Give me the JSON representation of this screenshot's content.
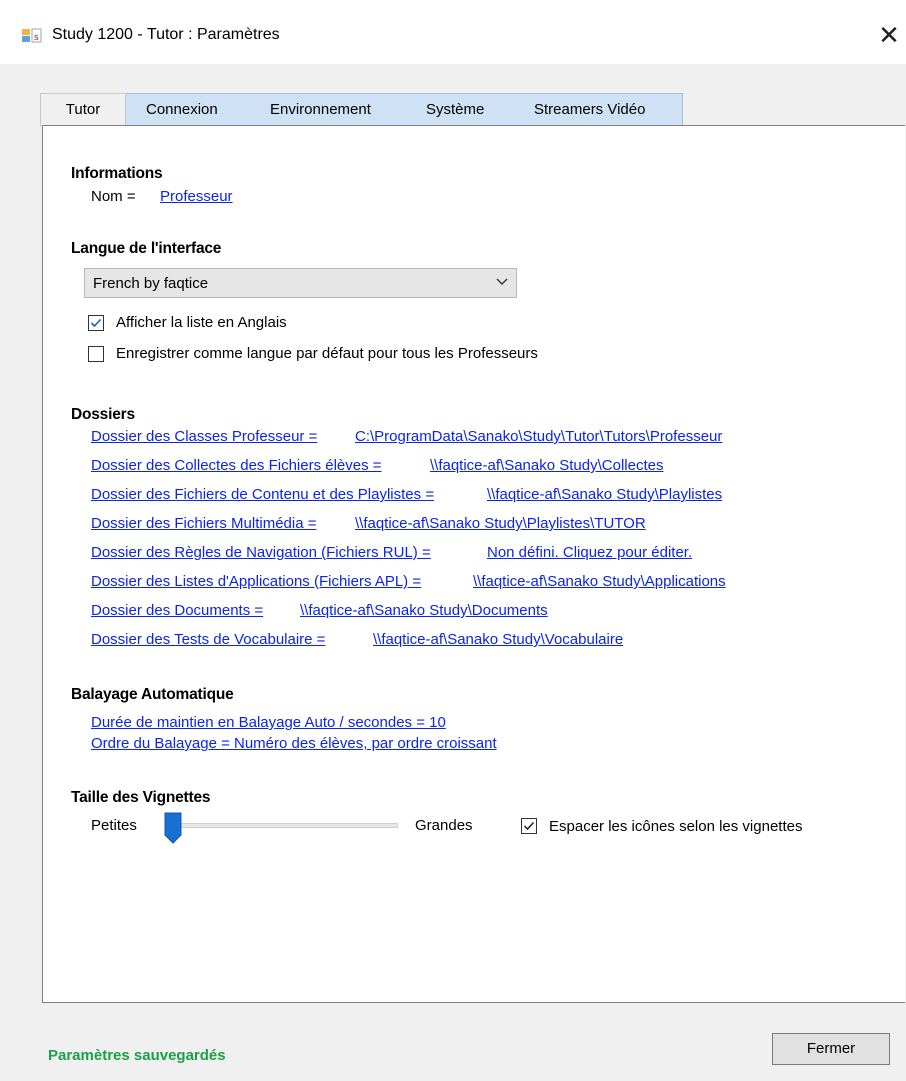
{
  "window": {
    "title": "Study 1200 - Tutor : Paramètres",
    "close_icon": "close-icon",
    "app_icon": "study-app-icon"
  },
  "tabs": [
    {
      "label": "Tutor",
      "active": true
    },
    {
      "label": "Connexion",
      "active": false
    },
    {
      "label": "Environnement",
      "active": false
    },
    {
      "label": "Système",
      "active": false
    },
    {
      "label": "Streamers Vidéo",
      "active": false
    }
  ],
  "informations": {
    "heading": "Informations",
    "nom_label": "Nom =",
    "nom_value": "Professeur"
  },
  "langue": {
    "heading": "Langue de l'interface",
    "selected": "French by faqtice",
    "check_english": {
      "label": "Afficher la liste en Anglais",
      "checked": true
    },
    "check_default": {
      "label": "Enregistrer comme langue par défaut pour tous les Professeurs",
      "checked": false
    }
  },
  "dossiers": {
    "heading": "Dossiers",
    "items": [
      {
        "label": "Dossier des Classes Professeur =",
        "value": "C:\\ProgramData\\Sanako\\Study\\Tutor\\Tutors\\Professeur"
      },
      {
        "label": "Dossier des Collectes des Fichiers élèves =",
        "value": "\\\\faqtice-af\\Sanako Study\\Collectes"
      },
      {
        "label": "Dossier des Fichiers de Contenu et des Playlistes =",
        "value": "\\\\faqtice-af\\Sanako Study\\Playlistes"
      },
      {
        "label": "Dossier des Fichiers Multimédia =",
        "value": "\\\\faqtice-af\\Sanako Study\\Playlistes\\TUTOR"
      },
      {
        "label": "Dossier des Règles de Navigation (Fichiers RUL) =",
        "value": "Non défini. Cliquez pour éditer."
      },
      {
        "label": "Dossier des Listes d'Applications (Fichiers APL) =",
        "value": "\\\\faqtice-af\\Sanako Study\\Applications"
      },
      {
        "label": "Dossier des Documents =",
        "value": "\\\\faqtice-af\\Sanako Study\\Documents"
      },
      {
        "label": "Dossier des Tests de Vocabulaire =",
        "value": "\\\\faqtice-af\\Sanako Study\\Vocabulaire"
      }
    ]
  },
  "balayage": {
    "heading": "Balayage Automatique",
    "duree": "Durée de maintien en Balayage Auto / secondes = 10",
    "ordre": "Ordre du Balayage = Numéro des élèves, par ordre croissant"
  },
  "vignettes": {
    "heading": "Taille des Vignettes",
    "min_label": "Petites",
    "max_label": "Grandes",
    "slider_value_fraction": 0.0,
    "check_espacer": {
      "label": "Espacer les icônes selon les vignettes",
      "checked": true
    }
  },
  "footer": {
    "status": "Paramètres sauvegardés",
    "close_button": "Fermer"
  },
  "colors": {
    "link": "#0b24e8",
    "status": "#1aa04a",
    "tab_strip": "#cfe2f5",
    "slider_thumb": "#1a6fd1"
  }
}
